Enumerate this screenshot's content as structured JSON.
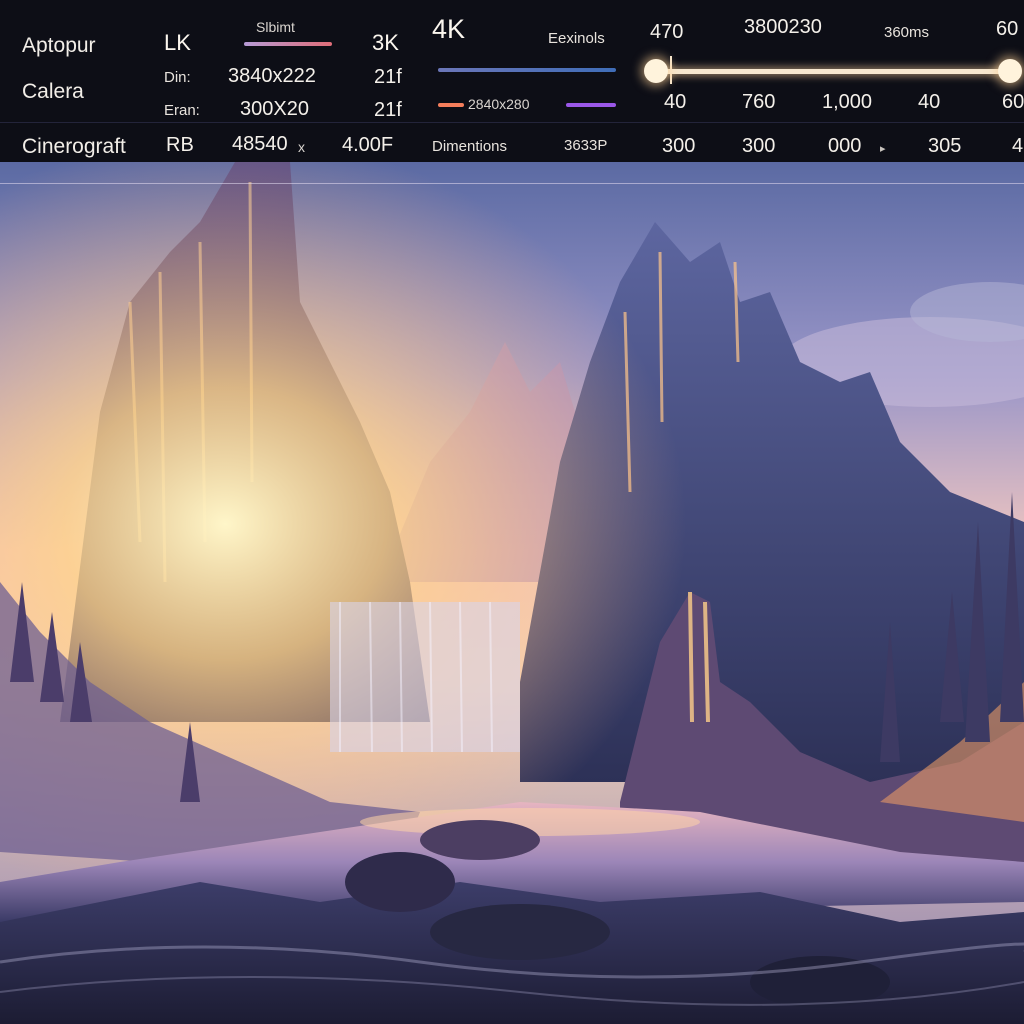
{
  "panel": {
    "col1": {
      "row1": "Aptopur",
      "row2": "Calera",
      "row3": "Cinerograft"
    },
    "col2": {
      "row1": "LK",
      "row2": "Din:",
      "row3": "Eran:",
      "row4": "RB"
    },
    "col3": {
      "swatch_label": "Slbimt",
      "row2": "3840x222",
      "row3": "300X20",
      "row4": "48540",
      "row4_suffix": "x"
    },
    "col4": {
      "row1": "3K",
      "row2": "21f",
      "row3": "21f",
      "row4": "4.00F"
    },
    "col5": {
      "row1": "4K",
      "swatch_label": "2840x280",
      "row4": "Dimentions"
    },
    "col6": {
      "row1": "Eexinols",
      "row4": "3633P"
    },
    "slider": {
      "top_labels": [
        "470",
        "3800230",
        "360ms",
        "60"
      ],
      "bottom_labels": [
        "40",
        "760",
        "1,000",
        "40",
        "60"
      ],
      "value_fraction": 1.0
    },
    "bottom_row": [
      "300",
      "300",
      "000",
      "305",
      "4"
    ],
    "colors": {
      "swatch1_start": "#b69bd6",
      "swatch1_end": "#e06d78",
      "swatch2_start": "#6b76b8",
      "swatch2_end": "#3f6db8",
      "swatch3_start": "#f47e5c",
      "swatch3_end": "#9a57e8",
      "slider": "#f6e7cf"
    }
  },
  "scene": {
    "icon": "landscape-render-icon"
  }
}
